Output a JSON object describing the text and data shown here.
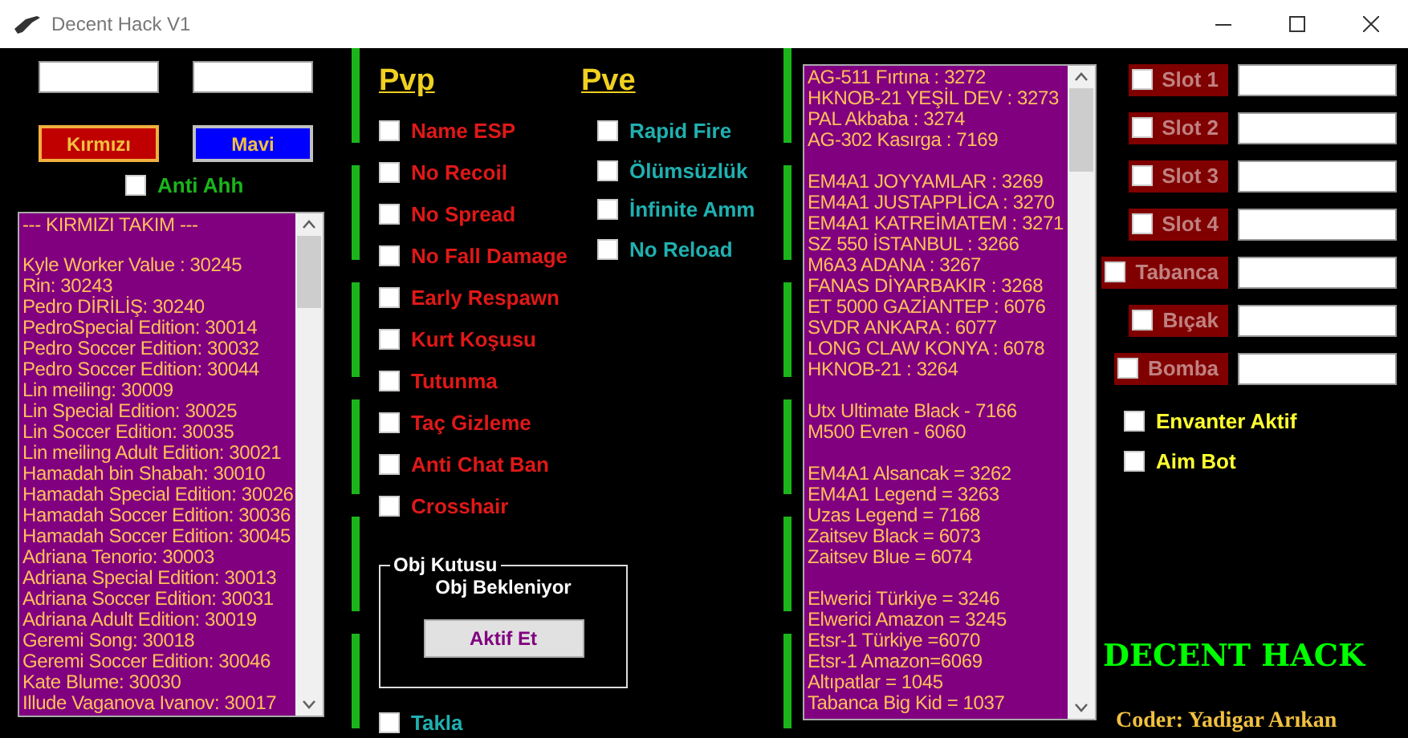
{
  "window": {
    "title": "Decent Hack V1"
  },
  "team_fields": [
    {
      "kind": "text"
    },
    {
      "kind": "text"
    }
  ],
  "team_buttons": [
    {
      "label": "Kırmızı",
      "color": "#c00000"
    },
    {
      "label": "Mavi",
      "color": "#0000ff"
    }
  ],
  "anti_ahh": {
    "label": "Anti Ahh",
    "checked": false
  },
  "team_list": {
    "header": "--- KIRMIZI TAKIM ---",
    "items": [
      "Kyle Worker Value : 30245",
      "Rin: 30243",
      "Pedro DİRİLİŞ: 30240",
      "PedroSpecial Edition: 30014",
      "Pedro Soccer Edition: 30032",
      "Pedro Soccer Edition: 30044",
      "Lin meiling: 30009",
      "Lin Special Edition: 30025",
      "Lin Soccer Edition: 30035",
      "Lin meiling Adult Edition: 30021",
      "Hamadah bin Shabah: 30010",
      "Hamadah Special Edition: 30026",
      "Hamadah Soccer Edition: 30036",
      "Hamadah Soccer Edition: 30045",
      "Adriana Tenorio: 30003",
      "Adriana Special Edition: 30013",
      "Adriana Soccer Edition: 30031",
      "Adriana Adult Edition: 30019",
      "Geremi Song: 30018",
      "Geremi Soccer Edition: 30046",
      "Kate Blume: 30030",
      "Illude Vaganova Ivanov: 30017"
    ]
  },
  "pvp": {
    "title": "Pvp",
    "items": [
      {
        "label": "Name ESP",
        "checked": false
      },
      {
        "label": "No Recoil",
        "checked": false
      },
      {
        "label": "No Spread",
        "checked": false
      },
      {
        "label": "No Fall Damage",
        "checked": false
      },
      {
        "label": "Early Respawn",
        "checked": false
      },
      {
        "label": "Kurt Koşusu",
        "checked": false
      },
      {
        "label": "Tutunma",
        "checked": false
      },
      {
        "label": "Taç Gizleme",
        "checked": false
      },
      {
        "label": "Anti Chat Ban",
        "checked": false
      },
      {
        "label": "Crosshair",
        "checked": false
      }
    ]
  },
  "pve": {
    "title": "Pve",
    "items": [
      {
        "label": "Rapid Fire",
        "checked": false
      },
      {
        "label": "Ölümsüzlük",
        "checked": false
      },
      {
        "label": "İnfinite Amm",
        "checked": false
      },
      {
        "label": "No Reload",
        "checked": false
      }
    ]
  },
  "obj_box": {
    "title": "Obj Kutusu",
    "status": "Obj Bekleniyor",
    "button": "Aktif Et"
  },
  "takla": {
    "label": "Takla",
    "checked": false
  },
  "weapon_list": {
    "groups": [
      [
        "AG-511 Fırtına : 3272",
        "HKNOB-21 YEŞİL DEV : 3273",
        "PAL Akbaba : 3274",
        "AG-302 Kasırga : 7169"
      ],
      [
        "EM4A1 JOYYAMLAR : 3269",
        "EM4A1 JUSTAPPLİCA : 3270",
        "EM4A1 KATREİMATEM : 3271",
        "SZ 550 İSTANBUL : 3266",
        "M6A3 ADANA : 3267",
        "FANAS DİYARBAKIR : 3268",
        "ET 5000 GAZİANTEP : 6076",
        "SVDR ANKARA : 6077",
        "LONG CLAW KONYA : 6078",
        "HKNOB-21 : 3264"
      ],
      [
        "Utx Ultimate Black - 7166",
        "M500 Evren - 6060"
      ],
      [
        "EM4A1 Alsancak = 3262",
        "EM4A1 Legend = 3263",
        "Uzas Legend = 7168",
        "Zaitsev Black = 6073",
        "Zaitsev Blue = 6074"
      ],
      [
        "Elwerici Türkiye = 3246",
        "Elwerici Amazon = 3245",
        "Etsr-1 Türkiye =6070",
        "Etsr-1 Amazon=6069",
        "Altıpatlar = 1045",
        "Tabanca Big Kid = 1037"
      ]
    ]
  },
  "slots": [
    {
      "label": "Slot 1",
      "checked": false
    },
    {
      "label": "Slot 2",
      "checked": false
    },
    {
      "label": "Slot 3",
      "checked": false
    },
    {
      "label": "Slot 4",
      "checked": false
    },
    {
      "label": "Tabanca",
      "checked": false
    },
    {
      "label": "Bıçak",
      "checked": false
    },
    {
      "label": "Bomba",
      "checked": false
    }
  ],
  "options": [
    {
      "label": "Envanter Aktif",
      "checked": false
    },
    {
      "label": "Aim Bot",
      "checked": false
    }
  ],
  "brand": "DECENT HACK",
  "coder": "Coder: Yadigar Arıkan"
}
